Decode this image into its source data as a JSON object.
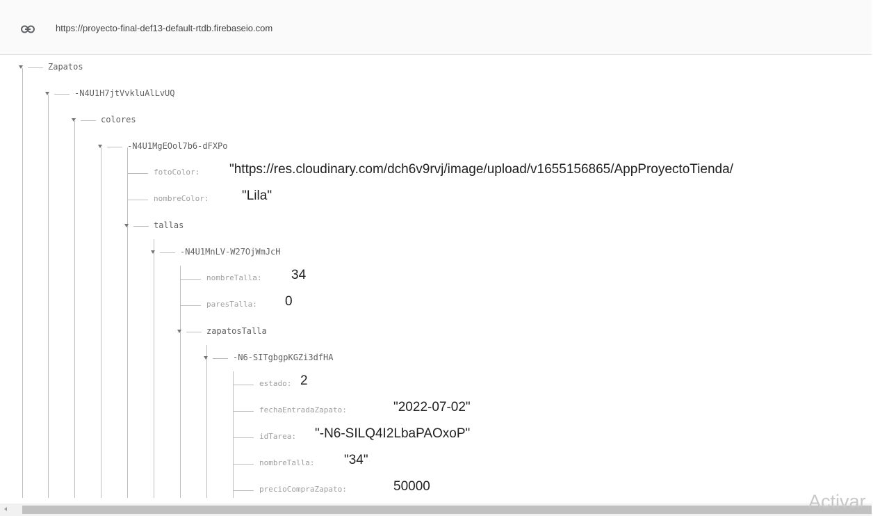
{
  "url_bar": {
    "url": "https://proyecto-final-def13-default-rtdb.firebaseio.com",
    "icon": "link-icon"
  },
  "tree": {
    "root": "Zapatos",
    "item_key": "-N4U1H7jtVvkluAlLvUQ",
    "colores_label": "colores",
    "color_key": "-N4U1MgEOol7b6-dFXPo",
    "fotoColor": {
      "key": "fotoColor",
      "value": "\"https://res.cloudinary.com/dch6v9rvj/image/upload/v1655156865/AppProyectoTienda/"
    },
    "nombreColor": {
      "key": "nombreColor",
      "value": "\"Lila\""
    },
    "tallas_label": "tallas",
    "talla_key": "-N4U1MnLV-W27OjWmJcH",
    "nombreTalla": {
      "key": "nombreTalla",
      "value": "34"
    },
    "paresTalla": {
      "key": "paresTalla",
      "value": "0"
    },
    "zapatosTalla_label": "zapatosTalla",
    "zapato_key": "-N6-SITgbgpKGZi3dfHA",
    "estado": {
      "key": "estado",
      "value": "2"
    },
    "fechaEntradaZapato": {
      "key": "fechaEntradaZapato",
      "value": "\"2022-07-02\""
    },
    "idTarea": {
      "key": "idTarea",
      "value": "\"-N6-SILQ4I2LbaPAOxoP\""
    },
    "nombreTallaZapato": {
      "key": "nombreTalla",
      "value": "\"34\""
    },
    "precioCompraZapato": {
      "key": "precioCompraZapato",
      "value": "50000"
    }
  },
  "watermark": "Activar"
}
